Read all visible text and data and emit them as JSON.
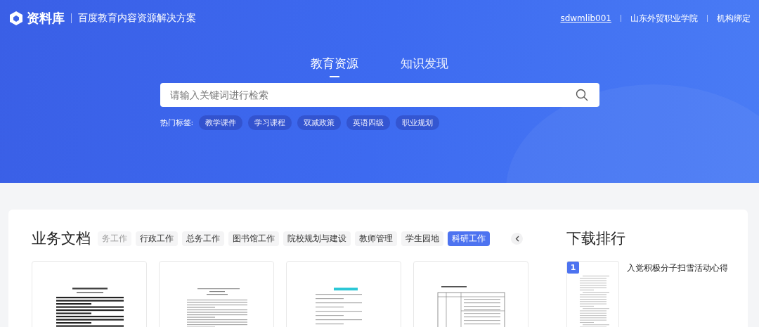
{
  "header": {
    "logo": "资料库",
    "tagline": "百度教育内容资源解决方案",
    "user": "sdwmlib001",
    "school": "山东外贸职业学院",
    "bind": "机构绑定"
  },
  "search_tabs": [
    {
      "label": "教育资源",
      "selected": true
    },
    {
      "label": "知识发现",
      "selected": false
    }
  ],
  "search": {
    "placeholder": "请输入关键词进行检索"
  },
  "hot_tags": {
    "label": "热门标签:",
    "tags": [
      "教学课件",
      "学习课程",
      "双减政策",
      "英语四级",
      "职业规划"
    ]
  },
  "docs": {
    "title": "业务文档",
    "categories": [
      {
        "label": "务工作",
        "selected": false,
        "faded": true
      },
      {
        "label": "行政工作",
        "selected": false,
        "faded": false
      },
      {
        "label": "总务工作",
        "selected": false,
        "faded": false
      },
      {
        "label": "图书馆工作",
        "selected": false,
        "faded": false
      },
      {
        "label": "院校规划与建设",
        "selected": false,
        "faded": false
      },
      {
        "label": "教师管理",
        "selected": false,
        "faded": false
      },
      {
        "label": "学生园地",
        "selected": false,
        "faded": false
      },
      {
        "label": "科研工作",
        "selected": true,
        "faded": false
      }
    ],
    "cards": [
      {
        "kind": "bold"
      },
      {
        "kind": "plain"
      },
      {
        "kind": "list"
      },
      {
        "kind": "table"
      }
    ]
  },
  "ranking": {
    "title": "下载排行",
    "items": [
      {
        "rank": "1",
        "title": "入党积极分子扫雪活动心得"
      }
    ]
  }
}
